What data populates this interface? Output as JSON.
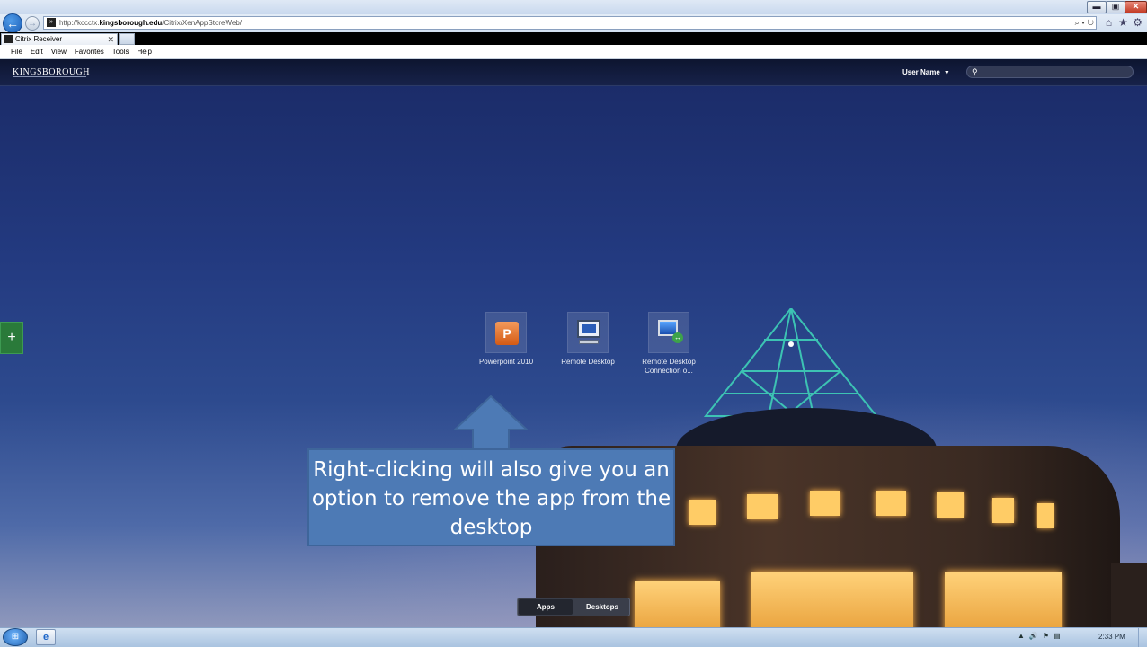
{
  "browser": {
    "window_controls": {
      "minimize": "▬",
      "maximize": "▣",
      "close": "✕"
    },
    "back_glyph": "←",
    "forward_glyph": "→",
    "url": {
      "prefix": "http://kccctx.",
      "domain": "kingsborough.edu",
      "suffix": "/Citrix/XenAppStoreWeb/",
      "tools": "⌕ ▾ ↻"
    },
    "tab": {
      "title": "Citrix Receiver",
      "close": "✕"
    },
    "menu": [
      "File",
      "Edit",
      "View",
      "Favorites",
      "Tools",
      "Help"
    ],
    "nav_icons": {
      "home": "⌂",
      "favorites": "★",
      "settings": "⚙"
    }
  },
  "citrix": {
    "logo": "KINGSBOROUGH",
    "user_name": "User Name",
    "user_caret": "▼",
    "search_glyph": "⚲",
    "search_placeholder": "",
    "add_glyph": "+",
    "apps": [
      {
        "label": "Powerpoint 2010",
        "icon": "powerpoint-icon",
        "glyph": "P"
      },
      {
        "label": "Remote Desktop",
        "icon": "remote-desktop-icon"
      },
      {
        "label": "Remote Desktop Connection o...",
        "icon": "remote-desktop-connection-icon",
        "glyph": "↔"
      }
    ],
    "view_switcher": {
      "apps": "Apps",
      "desktops": "Desktops",
      "selected": "Apps"
    }
  },
  "callout": {
    "text": "Right-clicking will also give you an option to remove the app from the desktop",
    "color": "#4d7ab5"
  },
  "taskbar": {
    "start_glyph": "⊞",
    "ie_glyph": "e",
    "tray": [
      "▲",
      "🔊",
      "⚑",
      "▤"
    ],
    "clock": "2:33 PM"
  }
}
